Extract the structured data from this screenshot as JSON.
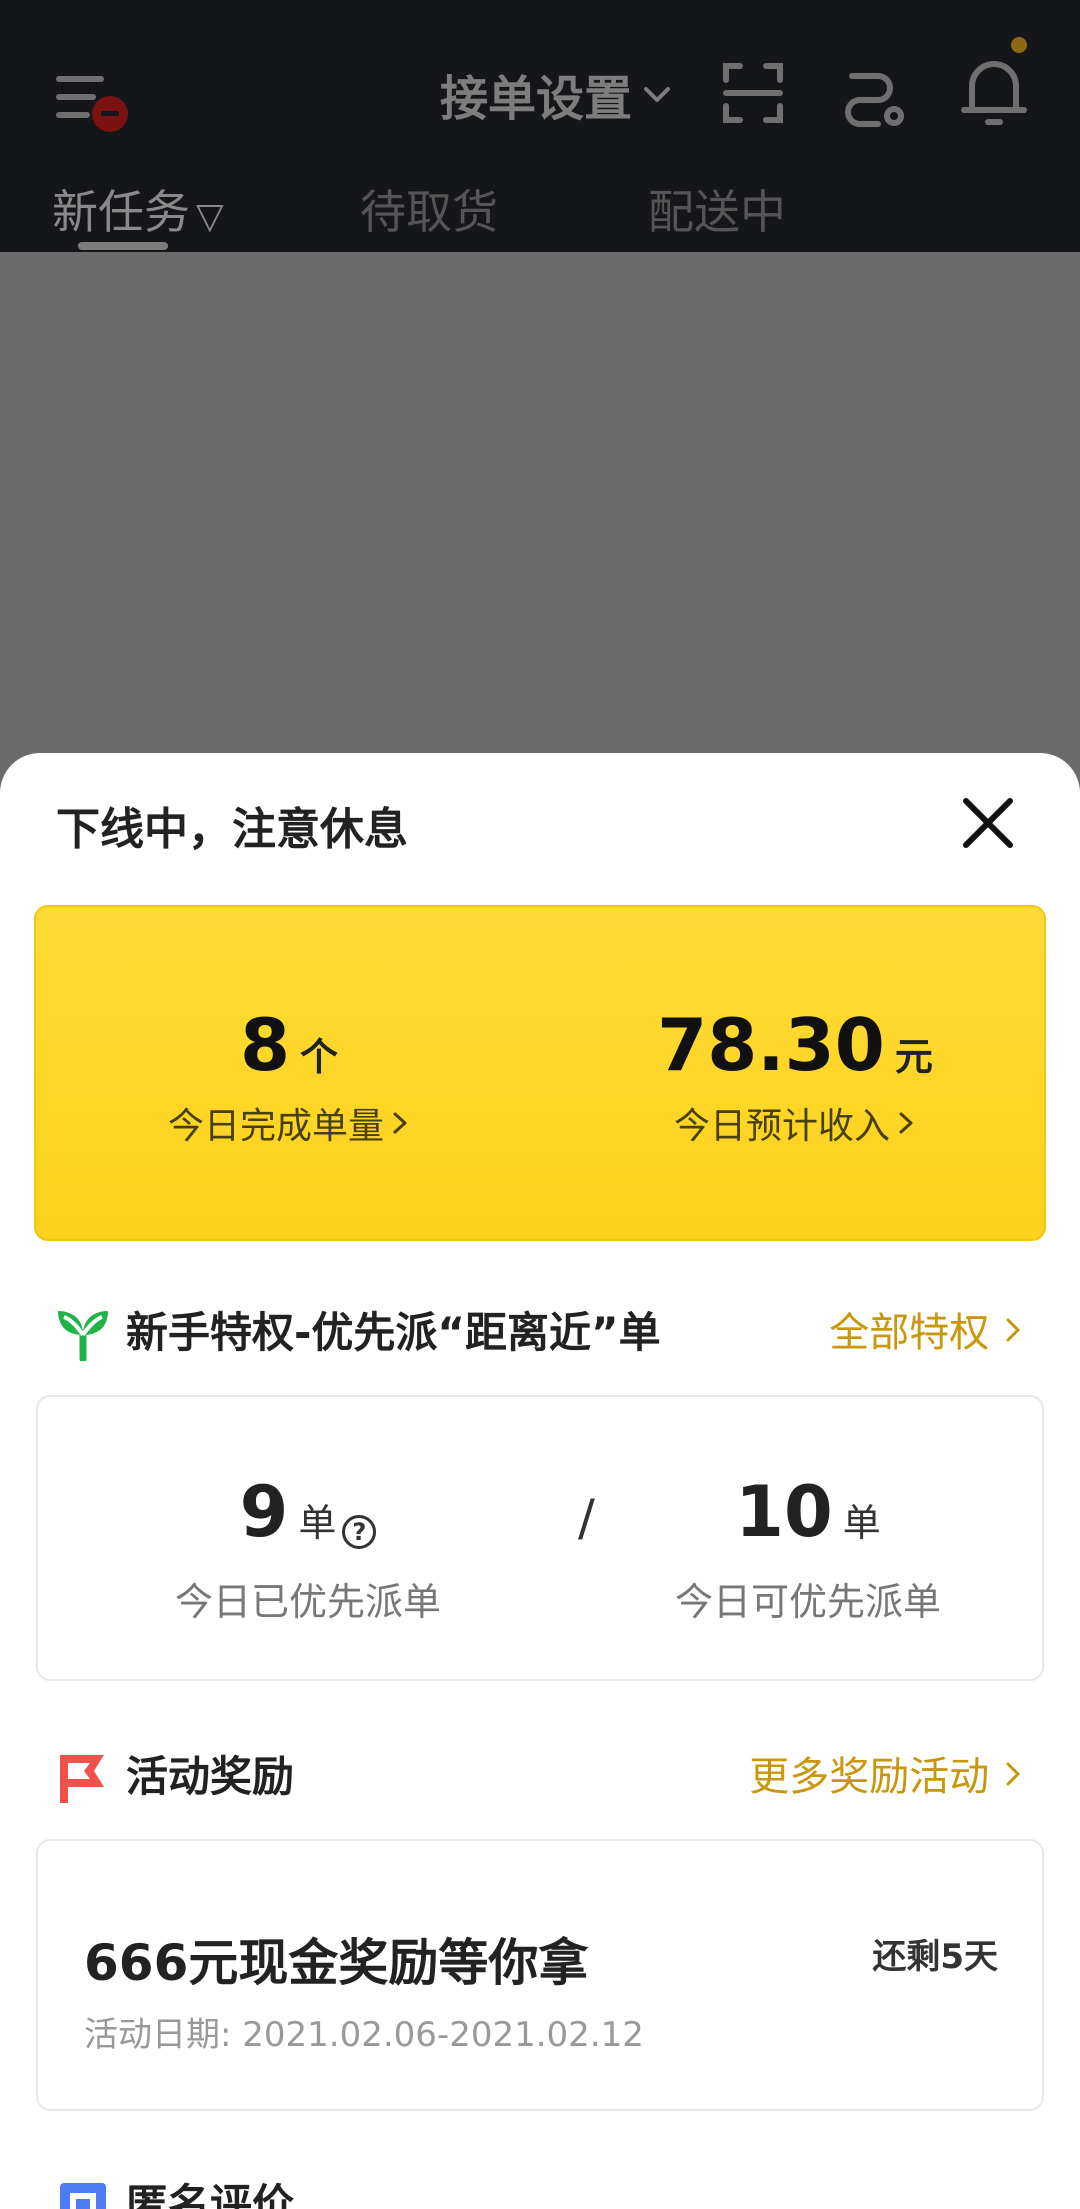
{
  "header": {
    "order_settings_label": "接单设置",
    "tabs": [
      {
        "label": "新任务",
        "filter_glyph": "▽"
      },
      {
        "label": "待取货"
      },
      {
        "label": "配送中"
      }
    ],
    "icons": [
      "menu-icon",
      "scan-icon",
      "route-icon",
      "bell-icon"
    ],
    "notification_dot_color": "#8a6a12"
  },
  "sheet": {
    "title": "下线中，注意休息",
    "stats": {
      "orders_completed": {
        "value": "8",
        "unit": "个",
        "caption": "今日完成单量"
      },
      "estimated_income": {
        "value": "78.30",
        "unit": "元",
        "caption": "今日预计收入"
      }
    },
    "privilege": {
      "title": "新手特权-优先派“距离近”单",
      "link": "全部特权",
      "dispatched": {
        "value": "9",
        "unit": "单",
        "caption": "今日已优先派单"
      },
      "separator": "/",
      "available": {
        "value": "10",
        "unit": "单",
        "caption": "今日可优先派单"
      }
    },
    "activity": {
      "title": "活动奖励",
      "link": "更多奖励活动",
      "item": {
        "title": "666元现金奖励等你拿",
        "remaining": "还剩5天",
        "date": "活动日期: 2021.02.06-2021.02.12"
      }
    },
    "anonymous_review": {
      "title": "匿名评价"
    }
  },
  "colors": {
    "accent_yellow": "#fdd52a",
    "link_gold": "#c9960c",
    "sprout_green": "#1fb34a",
    "flag_red": "#f0524a",
    "review_blue": "#4d7cf5"
  }
}
